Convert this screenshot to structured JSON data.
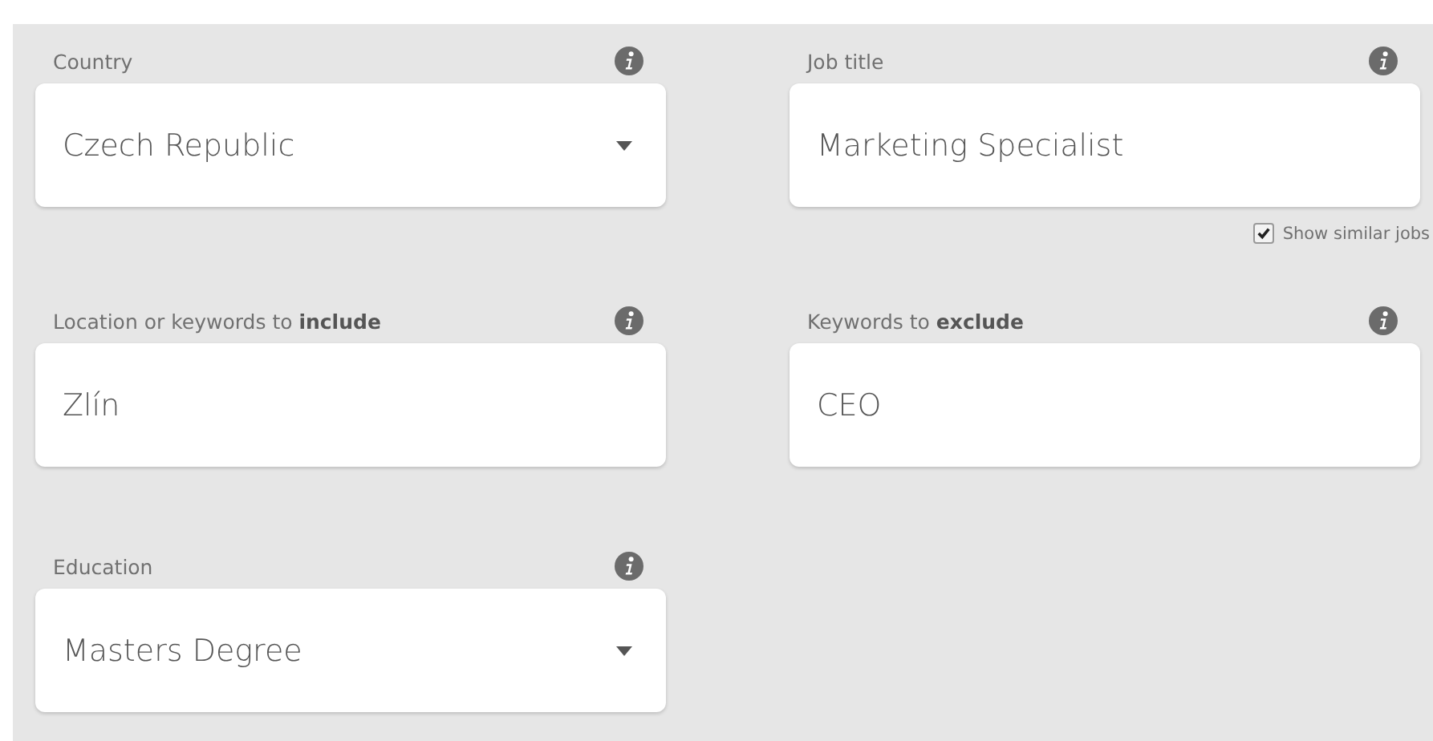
{
  "fields": [
    {
      "kind": "select",
      "label": "Country",
      "value": "Czech Republic"
    },
    {
      "kind": "text",
      "label": "Job title",
      "value": "Marketing Specialist",
      "option": {
        "label": "Show similar jobs",
        "checked": true
      }
    },
    {
      "kind": "text",
      "label": "Location or keywords to **include**",
      "value": "Zlín"
    },
    {
      "kind": "text",
      "label": "Keywords to **exclude**",
      "value": "CEO"
    },
    {
      "kind": "select",
      "label": "Education",
      "value": "Masters Degree"
    }
  ]
}
